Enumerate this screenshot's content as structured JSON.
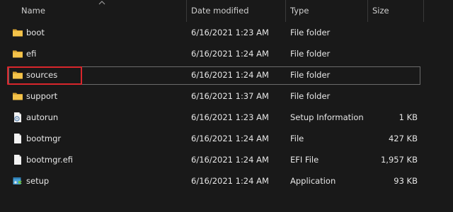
{
  "columns": {
    "name": "Name",
    "date": "Date modified",
    "type": "Type",
    "size": "Size"
  },
  "files": [
    {
      "name": "boot",
      "date": "6/16/2021 1:23 AM",
      "type": "File folder",
      "size": "",
      "icon": "folder-icon"
    },
    {
      "name": "efi",
      "date": "6/16/2021 1:24 AM",
      "type": "File folder",
      "size": "",
      "icon": "folder-icon"
    },
    {
      "name": "sources",
      "date": "6/16/2021 1:24 AM",
      "type": "File folder",
      "size": "",
      "icon": "folder-icon",
      "selected": true
    },
    {
      "name": "support",
      "date": "6/16/2021 1:37 AM",
      "type": "File folder",
      "size": "",
      "icon": "folder-icon"
    },
    {
      "name": "autorun",
      "date": "6/16/2021 1:23 AM",
      "type": "Setup Information",
      "size": "1 KB",
      "icon": "setup-info-icon"
    },
    {
      "name": "bootmgr",
      "date": "6/16/2021 1:24 AM",
      "type": "File",
      "size": "427 KB",
      "icon": "file-icon"
    },
    {
      "name": "bootmgr.efi",
      "date": "6/16/2021 1:24 AM",
      "type": "EFI File",
      "size": "1,957 KB",
      "icon": "file-icon"
    },
    {
      "name": "setup",
      "date": "6/16/2021 1:24 AM",
      "type": "Application",
      "size": "93 KB",
      "icon": "application-icon"
    }
  ],
  "colors": {
    "background": "#191919",
    "text": "#e6e6e6",
    "folder": "#f4c34a",
    "highlight": "#d9262c",
    "selection_outline": "#6b6b6b"
  }
}
